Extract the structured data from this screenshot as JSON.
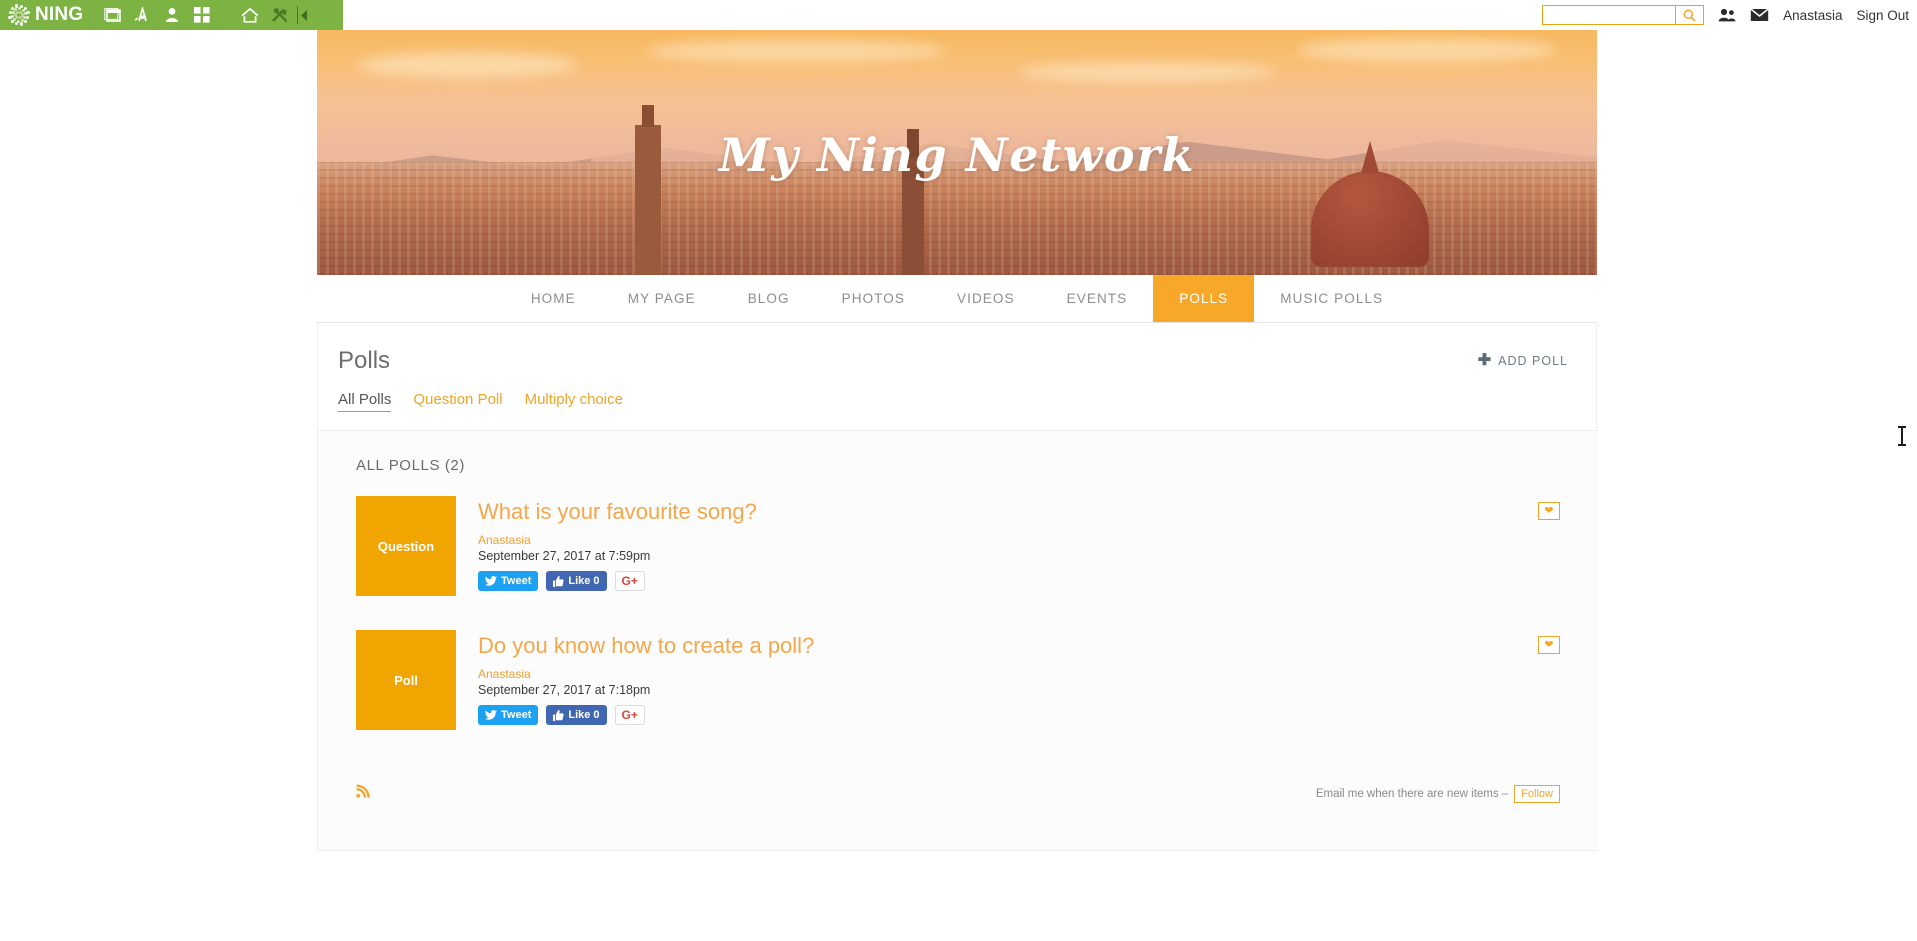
{
  "admin_bar": {
    "brand": "NING",
    "icons": [
      {
        "name": "site-preview-icon",
        "label": "Site Preview"
      },
      {
        "name": "appearance-icon",
        "label": "Appearance"
      },
      {
        "name": "members-icon",
        "label": "Members"
      },
      {
        "name": "features-grid-icon",
        "label": "Features"
      },
      {
        "name": "home-icon",
        "label": "Home"
      },
      {
        "name": "tools-icon",
        "label": "Tools"
      }
    ],
    "collapse_label": "◀"
  },
  "top_right": {
    "search": {
      "value": "",
      "placeholder": ""
    },
    "search_icon": "search-icon",
    "invite_icon": "invite-friends-icon",
    "messages_icon": "messages-icon",
    "user_name": "Anastasia",
    "sign_out": "Sign Out"
  },
  "banner": {
    "title": "My Ning Network"
  },
  "nav": {
    "items": [
      {
        "label": "HOME",
        "active": false
      },
      {
        "label": "MY PAGE",
        "active": false
      },
      {
        "label": "BLOG",
        "active": false
      },
      {
        "label": "PHOTOS",
        "active": false
      },
      {
        "label": "VIDEOS",
        "active": false
      },
      {
        "label": "EVENTS",
        "active": false
      },
      {
        "label": "POLLS",
        "active": true
      },
      {
        "label": "MUSIC POLLS",
        "active": false
      }
    ]
  },
  "main": {
    "page_title": "Polls",
    "add_poll_label": "ADD POLL",
    "add_poll_plus": "✚",
    "tabs": [
      {
        "label": "All Polls",
        "active": true
      },
      {
        "label": "Question Poll",
        "active": false
      },
      {
        "label": "Multiply choice",
        "active": false
      }
    ],
    "panel_title": "ALL POLLS (2)",
    "polls": [
      {
        "thumb_label": "Question",
        "title": "What is your favourite song?",
        "author": "Anastasia",
        "date": "September 27, 2017 at 7:59pm",
        "tweet_label": "Tweet",
        "like_label": "Like 0",
        "gplus_label": "G+",
        "favorite_icon": "heart-icon"
      },
      {
        "thumb_label": "Poll",
        "title": "Do you know how to create a poll?",
        "author": "Anastasia",
        "date": "September 27, 2017 at 7:18pm",
        "tweet_label": "Tweet",
        "like_label": "Like 0",
        "gplus_label": "G+",
        "favorite_icon": "heart-icon"
      }
    ],
    "footer": {
      "rss_icon": "rss-icon",
      "follow_text": "Email me when there are new items –",
      "follow_label": "Follow"
    }
  },
  "colors": {
    "ning_green": "#7cb342",
    "accent_orange": "#f0a42a",
    "thumb_orange": "#f0a500",
    "nav_active": "#f7a828",
    "twitter_blue": "#1da1f2",
    "facebook_blue": "#4267b2",
    "gplus_red": "#db4437"
  }
}
